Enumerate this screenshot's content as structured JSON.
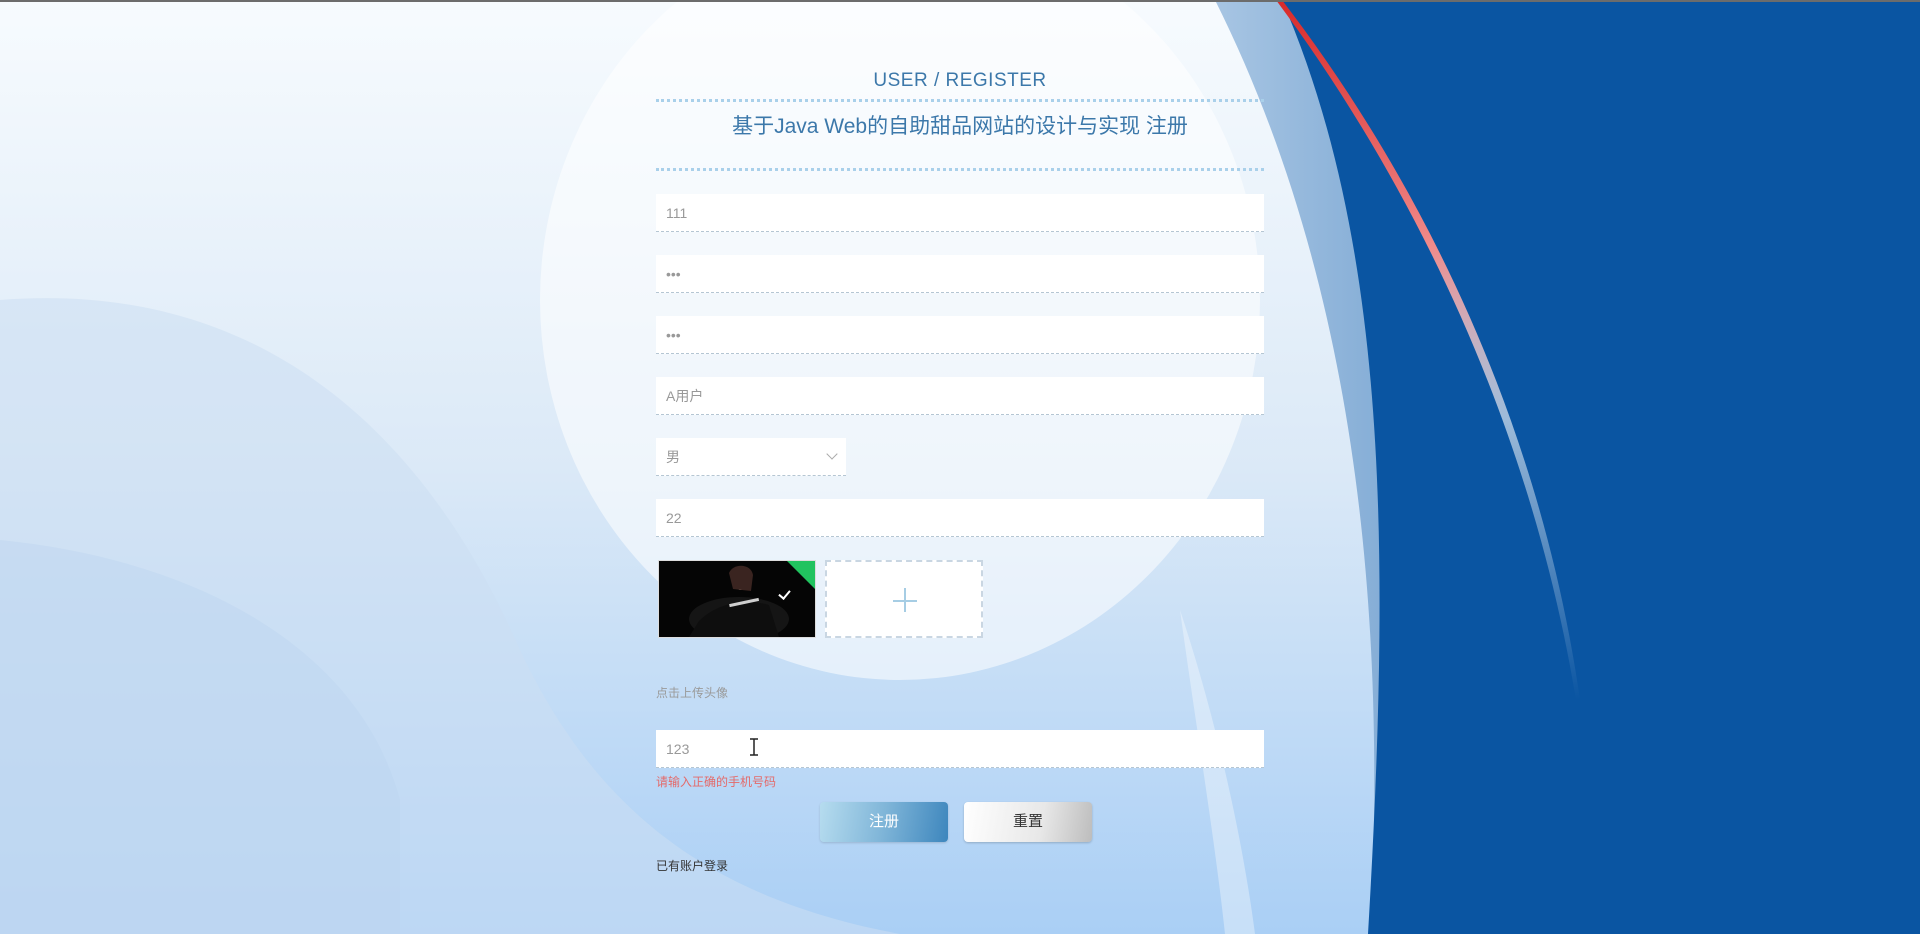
{
  "header": {
    "subtitle": "USER / REGISTER",
    "title": "基于Java Web的自助甜品网站的设计与实现 注册"
  },
  "fields": {
    "account": "111",
    "password": "•••",
    "confirm_password": "•••",
    "name": "A用户",
    "gender": "男",
    "age": "22",
    "phone": "123"
  },
  "avatar": {
    "hint": "点击上传头像",
    "upload_icon": "plus-icon",
    "uploaded_badge_icon": "check-icon"
  },
  "validation": {
    "phone_error": "请输入正确的手机号码"
  },
  "buttons": {
    "submit": "注册",
    "reset": "重置"
  },
  "links": {
    "login": "已有账户登录"
  },
  "colors": {
    "title": "#3c78aa",
    "error": "#e46a6a",
    "success_badge": "#21c35f",
    "background_blue": "#0a55a2"
  }
}
